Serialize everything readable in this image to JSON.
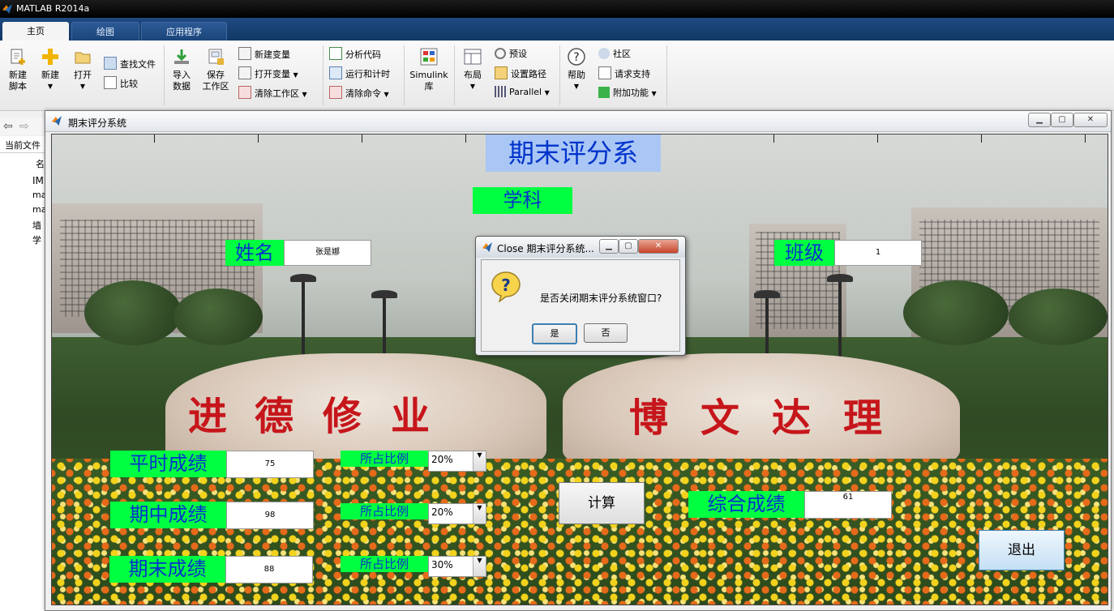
{
  "app": {
    "title": "MATLAB R2014a"
  },
  "tabs": [
    {
      "label": "主页"
    },
    {
      "label": "绘图"
    },
    {
      "label": "应用程序"
    }
  ],
  "ribbon": {
    "new_script": "新建\n脚本",
    "new_script_l1": "新建",
    "new_script_l2": "脚本",
    "new": "新建",
    "open": "打开",
    "find_files": "查找文件",
    "compare": "比较",
    "import_l1": "导入",
    "import_l2": "数据",
    "save_l1": "保存",
    "save_l2": "工作区",
    "new_variable": "新建变量",
    "open_variable": "打开变量",
    "clear_workspace": "清除工作区",
    "analyze_code": "分析代码",
    "run_time": "运行和计时",
    "clear_commands": "清除命令",
    "simulink_l1": "Simulink",
    "simulink_l2": "库",
    "layout": "布局",
    "preferences": "预设",
    "set_path": "设置路径",
    "parallel": "Parallel",
    "help": "帮助",
    "community": "社区",
    "request_support": "请求支持",
    "addons": "附加功能"
  },
  "left_panel": {
    "title": "当前文件",
    "col": "名",
    "items": [
      "IM",
      "ma",
      "ma",
      "墙",
      "学"
    ]
  },
  "figure": {
    "title": "期末评分系统",
    "heading": "期末评分系",
    "subject_label": "学科",
    "name_label": "姓名",
    "name_value": "张是娜",
    "class_label": "班级",
    "class_value": "1",
    "rows": [
      {
        "label": "平时成绩",
        "score": "75",
        "ratio_label": "所占比例",
        "ratio": "20%"
      },
      {
        "label": "期中成绩",
        "score": "98",
        "ratio_label": "所占比例",
        "ratio": "20%"
      },
      {
        "label": "期末成绩",
        "score": "88",
        "ratio_label": "所占比例",
        "ratio": "30%"
      }
    ],
    "calc_button": "计算",
    "total_label": "综合成绩",
    "total_value": "61",
    "exit_button": "退出",
    "rock_left": [
      "进",
      "德",
      "修",
      "业"
    ],
    "rock_right": [
      "博",
      "文",
      "达",
      "理"
    ]
  },
  "dialog": {
    "title": "Close 期末评分系统...",
    "message": "是否关闭期末评分系统窗口?",
    "yes": "是",
    "no": "否"
  },
  "colors": {
    "label_bg": "#00ff40",
    "label_text": "#0033cc",
    "heading_bg": "#a9c6f5"
  }
}
